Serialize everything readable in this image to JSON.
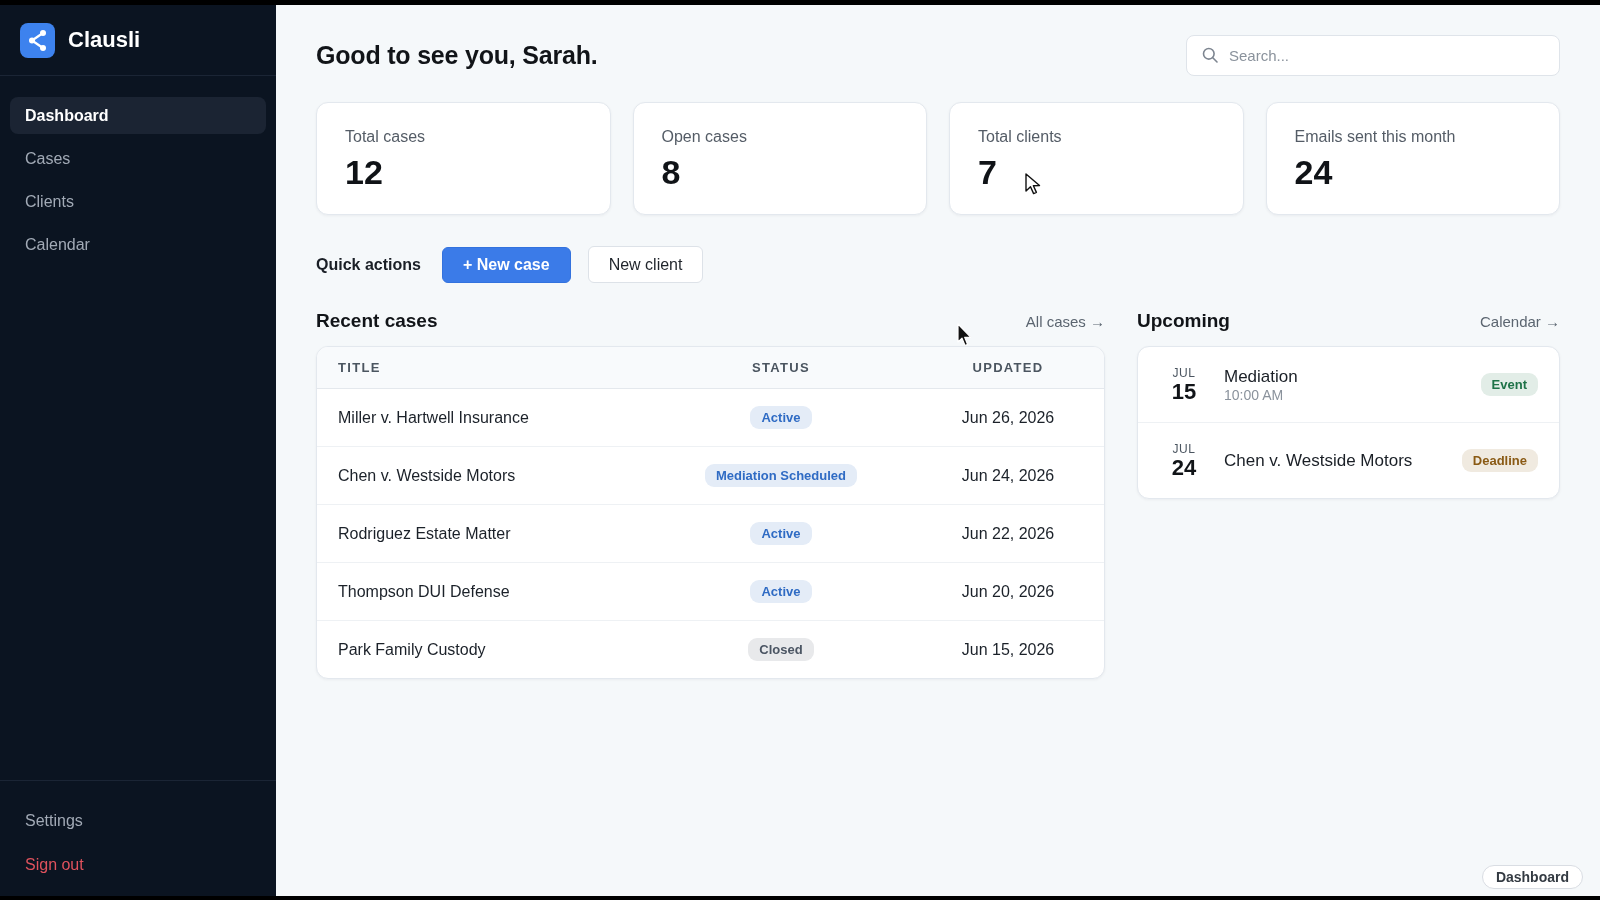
{
  "sidebar": {
    "brand": "Clausli",
    "items": [
      {
        "label": "Dashboard",
        "selected": true
      },
      {
        "label": "Cases",
        "selected": false
      },
      {
        "label": "Clients",
        "selected": false
      },
      {
        "label": "Calendar",
        "selected": false
      }
    ],
    "footer_items": [
      {
        "label": "Settings",
        "kind": "normal"
      },
      {
        "label": "Sign out",
        "kind": "danger"
      }
    ]
  },
  "header": {
    "greeting": "Good to see you, Sarah.",
    "search": {
      "placeholder": "Search..."
    }
  },
  "stats": [
    {
      "label": "Total cases",
      "value": "12"
    },
    {
      "label": "Open cases",
      "value": "8"
    },
    {
      "label": "Total clients",
      "value": "7"
    },
    {
      "label": "Emails sent this month",
      "value": "24"
    }
  ],
  "quick_actions": {
    "label": "Quick actions",
    "buttons": [
      {
        "label": "+ New case",
        "kind": "primary"
      },
      {
        "label": "New client",
        "kind": "secondary"
      }
    ]
  },
  "recent_cases": {
    "title": "Recent cases",
    "link": "All cases →",
    "columns": [
      "TITLE",
      "STATUS",
      "UPDATED"
    ],
    "rows": [
      {
        "title": "Miller v. Hartwell Insurance",
        "status": "Active",
        "color": "#2f6bc4",
        "updated": "Jun 26, 2026"
      },
      {
        "title": "Chen v. Westside Motors",
        "status": "Mediation Scheduled",
        "color": "#2f6bc4",
        "updated": "Jun 24, 2026"
      },
      {
        "title": "Rodriguez Estate Matter",
        "status": "Active",
        "color": "#2f6bc4",
        "updated": "Jun 22, 2026"
      },
      {
        "title": "Thompson DUI Defense",
        "status": "Active",
        "color": "#2f6bc4",
        "updated": "Jun 20, 2026"
      },
      {
        "title": "Park Family Custody",
        "status": "Closed",
        "color": "#4b5563",
        "updated": "Jun 15, 2026"
      }
    ]
  },
  "upcoming": {
    "title": "Upcoming",
    "link": "Calendar →",
    "events": [
      {
        "month": "JUL",
        "day": "15",
        "title": "Mediation",
        "time": "10:00 AM",
        "tag": "Event",
        "color": "#1d7247"
      },
      {
        "month": "JUL",
        "day": "24",
        "title": "Chen v. Westside Motors",
        "tag": "Deadline",
        "color": "#8a5a14"
      }
    ]
  },
  "page_label": "Dashboard"
}
